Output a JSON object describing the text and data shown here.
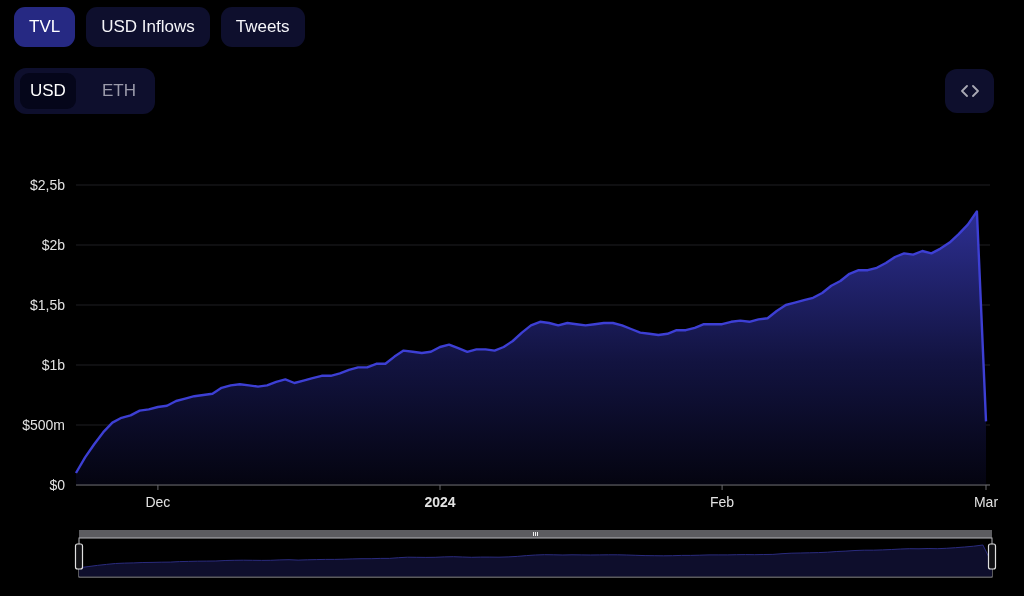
{
  "tabs": [
    {
      "label": "TVL",
      "selected": true
    },
    {
      "label": "USD Inflows",
      "selected": false
    },
    {
      "label": "Tweets",
      "selected": false
    }
  ],
  "currency_toggle": [
    {
      "label": "USD",
      "selected": true
    },
    {
      "label": "ETH",
      "selected": false
    }
  ],
  "chart": {
    "chart_data": {
      "type": "area",
      "grid": true,
      "x": [
        "2023-11-22",
        "2023-11-23",
        "2023-11-24",
        "2023-11-25",
        "2023-11-26",
        "2023-11-27",
        "2023-11-28",
        "2023-11-29",
        "2023-11-30",
        "2023-12-01",
        "2023-12-02",
        "2023-12-03",
        "2023-12-04",
        "2023-12-05",
        "2023-12-06",
        "2023-12-07",
        "2023-12-08",
        "2023-12-09",
        "2023-12-10",
        "2023-12-11",
        "2023-12-12",
        "2023-12-13",
        "2023-12-14",
        "2023-12-15",
        "2023-12-16",
        "2023-12-17",
        "2023-12-18",
        "2023-12-19",
        "2023-12-20",
        "2023-12-21",
        "2023-12-22",
        "2023-12-23",
        "2023-12-24",
        "2023-12-25",
        "2023-12-26",
        "2023-12-27",
        "2023-12-28",
        "2023-12-29",
        "2023-12-30",
        "2023-12-31",
        "2024-01-01",
        "2024-01-02",
        "2024-01-03",
        "2024-01-04",
        "2024-01-05",
        "2024-01-06",
        "2024-01-07",
        "2024-01-08",
        "2024-01-09",
        "2024-01-10",
        "2024-01-11",
        "2024-01-12",
        "2024-01-13",
        "2024-01-14",
        "2024-01-15",
        "2024-01-16",
        "2024-01-17",
        "2024-01-18",
        "2024-01-19",
        "2024-01-20",
        "2024-01-21",
        "2024-01-22",
        "2024-01-23",
        "2024-01-24",
        "2024-01-25",
        "2024-01-26",
        "2024-01-27",
        "2024-01-28",
        "2024-01-29",
        "2024-01-30",
        "2024-01-31",
        "2024-02-01",
        "2024-02-02",
        "2024-02-03",
        "2024-02-04",
        "2024-02-05",
        "2024-02-06",
        "2024-02-07",
        "2024-02-08",
        "2024-02-09",
        "2024-02-10",
        "2024-02-11",
        "2024-02-12",
        "2024-02-13",
        "2024-02-14",
        "2024-02-15",
        "2024-02-16",
        "2024-02-17",
        "2024-02-18",
        "2024-02-19",
        "2024-02-20",
        "2024-02-21",
        "2024-02-22",
        "2024-02-23",
        "2024-02-24",
        "2024-02-25",
        "2024-02-26",
        "2024-02-27",
        "2024-02-28",
        "2024-02-29",
        "2024-03-01"
      ],
      "series": [
        {
          "color": "#3d3fd4",
          "values": [
            100000000,
            230000000,
            340000000,
            440000000,
            520000000,
            560000000,
            580000000,
            620000000,
            630000000,
            650000000,
            660000000,
            700000000,
            720000000,
            740000000,
            750000000,
            760000000,
            810000000,
            830000000,
            840000000,
            830000000,
            820000000,
            830000000,
            860000000,
            880000000,
            850000000,
            870000000,
            890000000,
            910000000,
            910000000,
            930000000,
            960000000,
            980000000,
            980000000,
            1010000000,
            1010000000,
            1070000000,
            1120000000,
            1110000000,
            1100000000,
            1110000000,
            1150000000,
            1170000000,
            1140000000,
            1110000000,
            1130000000,
            1130000000,
            1120000000,
            1150000000,
            1200000000,
            1270000000,
            1330000000,
            1360000000,
            1350000000,
            1330000000,
            1350000000,
            1340000000,
            1330000000,
            1340000000,
            1350000000,
            1350000000,
            1330000000,
            1300000000,
            1270000000,
            1260000000,
            1250000000,
            1260000000,
            1290000000,
            1290000000,
            1310000000,
            1340000000,
            1340000000,
            1340000000,
            1360000000,
            1370000000,
            1360000000,
            1380000000,
            1390000000,
            1450000000,
            1500000000,
            1520000000,
            1540000000,
            1560000000,
            1600000000,
            1660000000,
            1700000000,
            1760000000,
            1790000000,
            1790000000,
            1810000000,
            1850000000,
            1900000000,
            1930000000,
            1920000000,
            1950000000,
            1930000000,
            1970000000,
            2020000000,
            2090000000,
            2170000000,
            2280000000,
            530000000
          ]
        }
      ],
      "xlim": [
        "2023-11-22",
        "2024-03-01"
      ],
      "ylim": [
        0,
        2500000000
      ],
      "xticks": [
        {
          "value": "2023-12-01",
          "label": "Dec"
        },
        {
          "value": "2024-01-01",
          "label": "2024"
        },
        {
          "value": "2024-02-01",
          "label": "Feb"
        },
        {
          "value": "2024-03-01",
          "label": "Mar"
        }
      ],
      "yticks": [
        {
          "value": 0,
          "label": "$0"
        },
        {
          "value": 500000000,
          "label": "$500m"
        },
        {
          "value": 1000000000,
          "label": "$1b"
        },
        {
          "value": 1500000000,
          "label": "$1,5b"
        },
        {
          "value": 2000000000,
          "label": "$2b"
        },
        {
          "value": 2500000000,
          "label": "$2,5b"
        }
      ]
    }
  },
  "zoom_slider": {
    "start_handle": {
      "level": 0
    },
    "end_handle": {
      "level": 1
    }
  }
}
